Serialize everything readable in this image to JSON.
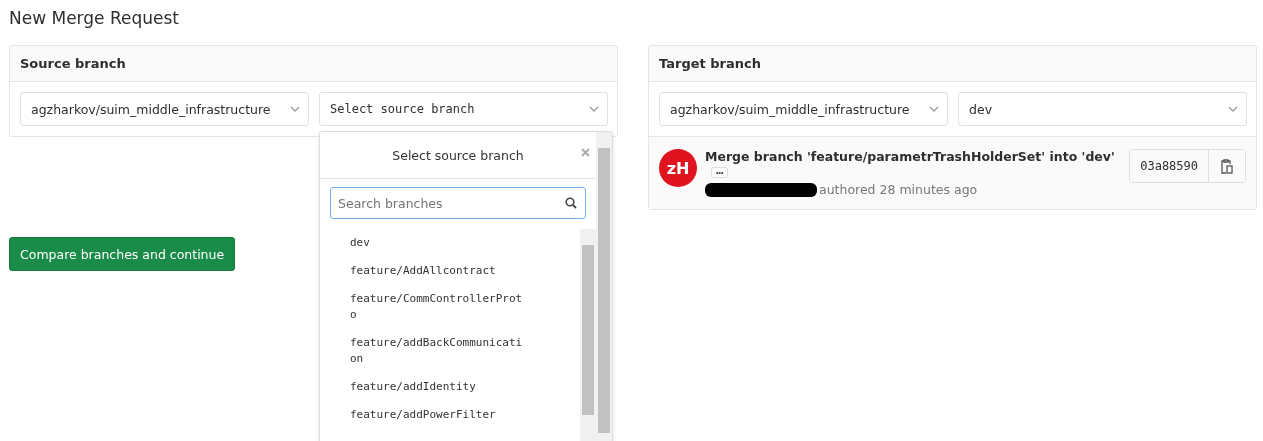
{
  "title": "New Merge Request",
  "source": {
    "heading": "Source branch",
    "project": "agzharkov/suim_middle_infrastructure",
    "branch_placeholder": "Select source branch"
  },
  "dropdown": {
    "title": "Select source branch",
    "search_placeholder": "Search branches",
    "branches": [
      {
        "name": "dev"
      },
      {
        "name": "feature/AddAllcontract"
      },
      {
        "name": "feature/CommControllerProto"
      },
      {
        "name": "feature/addBackCommunication"
      },
      {
        "name": "feature/addIdentity"
      },
      {
        "name": "feature/addPowerFilter"
      }
    ]
  },
  "target": {
    "heading": "Target branch",
    "project": "agzharkov/suim_middle_infrastructure",
    "branch": "dev",
    "commit": {
      "avatar": "zH",
      "message": "Merge branch 'feature/parametrTrashHolderSet' into 'dev'",
      "more": "•••",
      "authored": "authored 28 minutes ago",
      "sha": "03a88590"
    }
  },
  "compare_button": "Compare branches and continue"
}
